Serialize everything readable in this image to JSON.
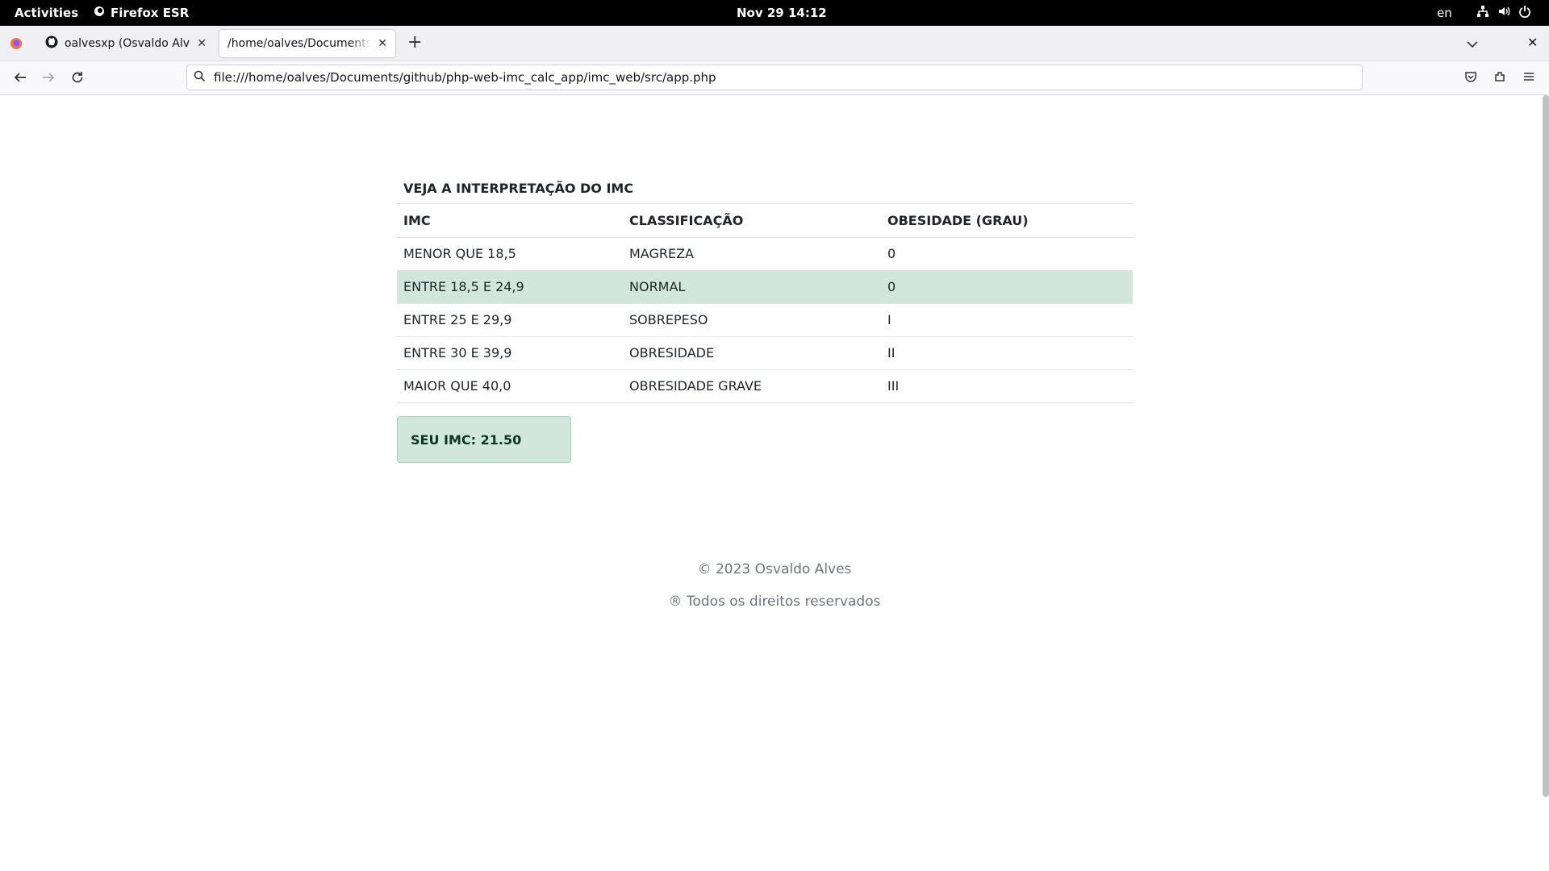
{
  "system": {
    "activities": "Activities",
    "app_name": "Firefox ESR",
    "clock": "Nov 29  14:12",
    "lang": "en"
  },
  "browser": {
    "tabs": [
      {
        "label": "oalvesxp (Osvaldo Alves)",
        "icon": "github-icon"
      },
      {
        "label": "/home/oalves/Documents/github/php-web-imc_calc_app/imc_web/src/app.php",
        "icon": ""
      }
    ],
    "url": "file:///home/oalves/Documents/github/php-web-imc_calc_app/imc_web/src/app.php"
  },
  "page": {
    "table_title": "VEJA A INTERPRETAÇÃO DO IMC",
    "headers": [
      "IMC",
      "CLASSIFICAÇÃO",
      "OBESIDADE (GRAU)"
    ],
    "rows": [
      {
        "imc": "MENOR QUE 18,5",
        "class": "MAGREZA",
        "grade": "0"
      },
      {
        "imc": "ENTRE 18,5 E 24,9",
        "class": "NORMAL",
        "grade": "0"
      },
      {
        "imc": "ENTRE 25 E 29,9",
        "class": "SOBREPESO",
        "grade": "I"
      },
      {
        "imc": "ENTRE 30 E 39,9",
        "class": "OBRESIDADE",
        "grade": "II"
      },
      {
        "imc": "MAIOR QUE 40,0",
        "class": "OBRESIDADE GRAVE",
        "grade": "III"
      }
    ],
    "highlight_row_color": "#d1e7dd",
    "result": "SEU IMC: 21.50",
    "footer_copyright": "© 2023 Osvaldo Alves",
    "footer_rights": "® Todos os direitos reservados"
  }
}
